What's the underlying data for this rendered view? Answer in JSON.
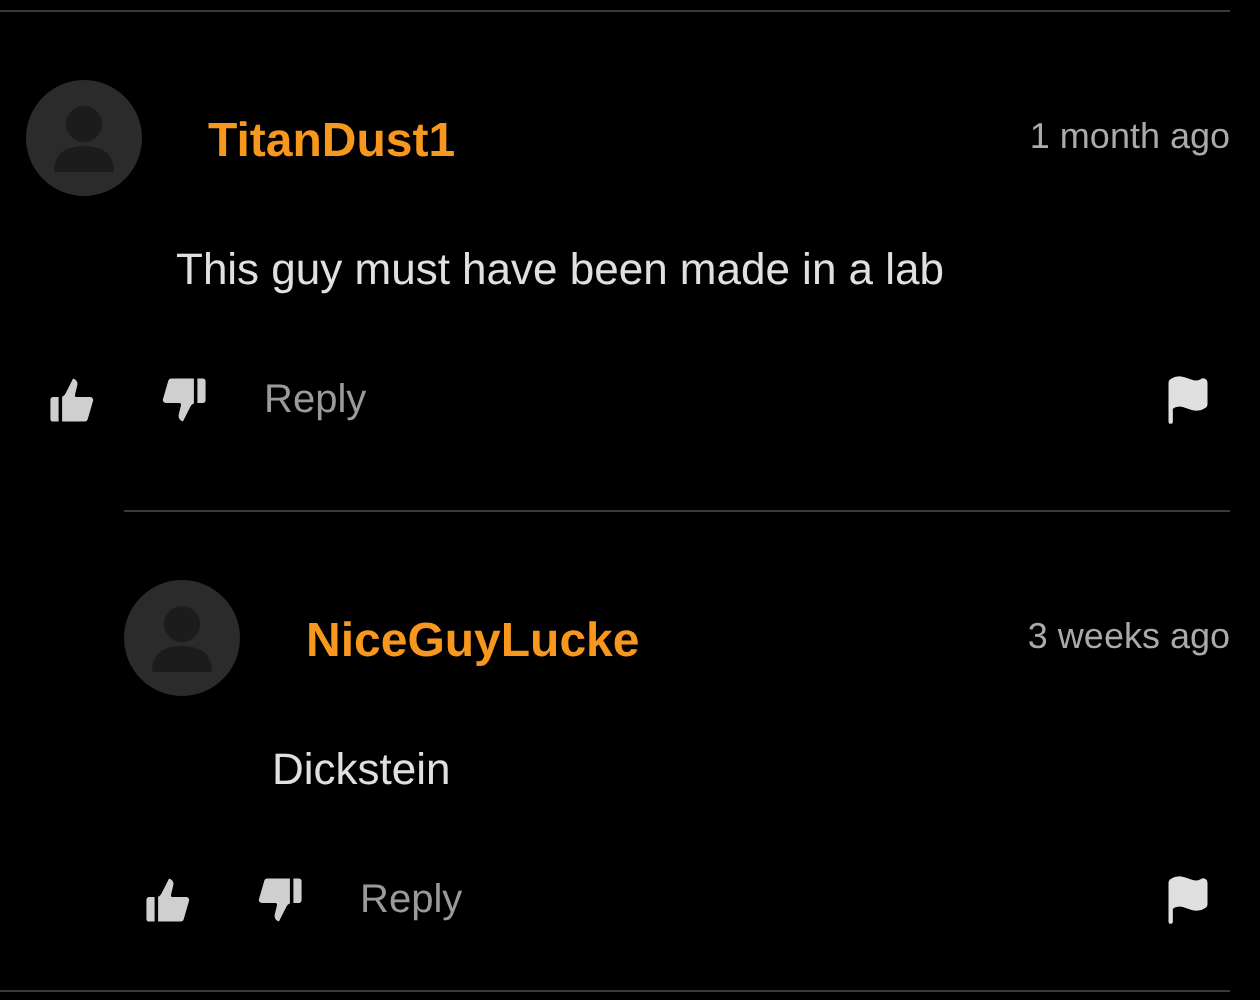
{
  "comments": [
    {
      "author": "TitanDust1",
      "time": "1 month ago",
      "text": "This guy must have been made in a lab",
      "reply_label": "Reply",
      "children": [
        {
          "author": "NiceGuyLucke",
          "time": "3 weeks ago",
          "text": "Dickstein",
          "reply_label": "Reply"
        }
      ]
    }
  ]
}
